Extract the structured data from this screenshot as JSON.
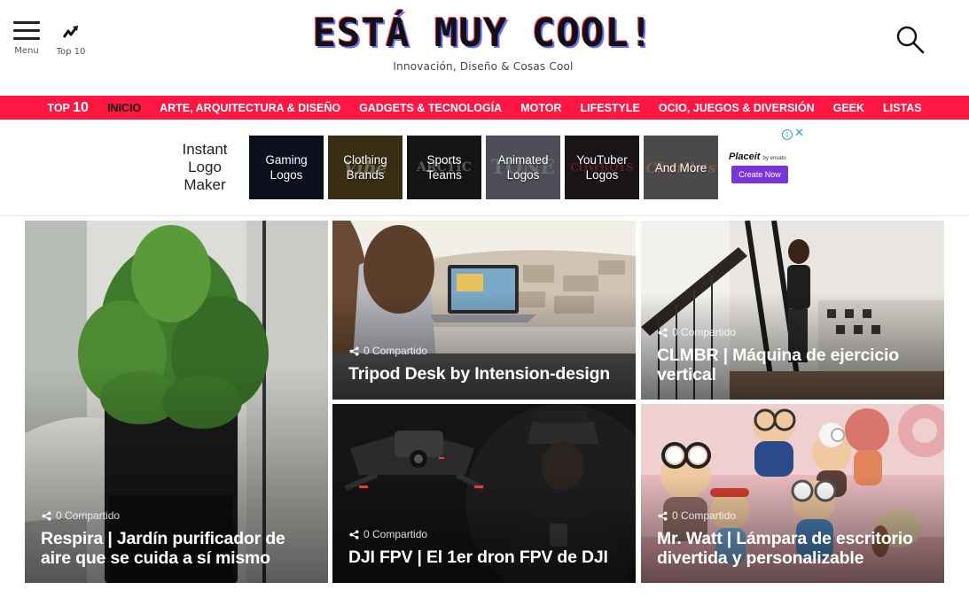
{
  "header": {
    "menu_label": "Menu",
    "top10_label": "Top 10",
    "site_title": "ESTÁ MUY COOL!",
    "tagline": "Innovación, Diseño & Cosas Cool"
  },
  "nav": {
    "items": [
      {
        "prefix": "TOP",
        "big": "10"
      },
      {
        "label": "INICIO"
      },
      {
        "label": "ARTE, ARQUITECTURA & DISEÑO"
      },
      {
        "label": "GADGETS & TECNOLOGÍA"
      },
      {
        "label": "MOTOR"
      },
      {
        "label": "LIFESTYLE"
      },
      {
        "label": "OCIO, JUEGOS & DIVERSIÓN"
      },
      {
        "label": "GEEK"
      },
      {
        "label": "LISTAS"
      }
    ],
    "accent_color": "#ff1744"
  },
  "ad": {
    "title_lines": [
      "Instant",
      "Logo",
      "Maker"
    ],
    "tiles": [
      {
        "label_lines": [
          "Gaming",
          "Logos"
        ],
        "deco": ""
      },
      {
        "label_lines": [
          "Clothing",
          "Brands"
        ],
        "deco": "Vibe"
      },
      {
        "label_lines": [
          "Sports",
          "Teams"
        ],
        "deco": "ARCTIC"
      },
      {
        "label_lines": [
          "Animated",
          "Logos"
        ],
        "deco": "TONE"
      },
      {
        "label_lines": [
          "YouTuber",
          "Logos"
        ],
        "deco": "COWBOYS"
      },
      {
        "label_lines": [
          "And More"
        ],
        "deco": "Charlie's"
      }
    ],
    "brand": "Placeit",
    "brand_sub": "by envato",
    "cta": "Create Now",
    "info_icon": "info-icon",
    "close_icon": "close-icon"
  },
  "articles": [
    {
      "share": "0 Compartido",
      "title": "Respira | Jardín purificador de aire que se cuida a sí mismo"
    },
    {
      "share": "0 Compartido",
      "title": "Tripod Desk by Intension-design"
    },
    {
      "share": "0 Compartido",
      "title": "CLMBR | Máquina de ejercicio vertical"
    },
    {
      "share": "0 Compartido",
      "title": "DJI FPV | El 1er dron FPV de DJI"
    },
    {
      "share": "0 Compartido",
      "title": "Mr. Watt | Lámpara de escritorio divertida y personalizable"
    }
  ]
}
